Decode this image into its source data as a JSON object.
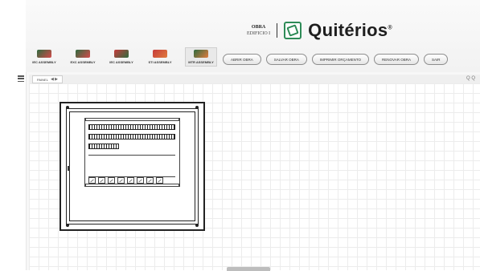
{
  "header": {
    "obra_label": "OBRA",
    "obra_value": "EDIFICIO I",
    "brand_name": "Quitérios"
  },
  "assemblies": [
    {
      "label": "IEC ASSEMBLY",
      "color1": "#2f6b3f",
      "color2": "#d44a4a",
      "active": false
    },
    {
      "label": "EXC ASSEMBLY",
      "color1": "#2f6b3f",
      "color2": "#d44a4a",
      "active": false
    },
    {
      "label": "IEC ASSEMBLY",
      "color1": "#c63c3c",
      "color2": "#2f6b3f",
      "active": false
    },
    {
      "label": "STI ASSEMBLY",
      "color1": "#c63c3c",
      "color2": "#e07b3d",
      "active": false
    },
    {
      "label": "MTR ASSEMBLY",
      "color1": "#2f6b3f",
      "color2": "#e07b3d",
      "active": true
    }
  ],
  "actions": [
    "ABRIR OBRA",
    "SALVAR OBRA",
    "IMPRIMIR ORÇAMENTO",
    "RENOVAR OBRA",
    "SAIR"
  ],
  "toolbar": {
    "tab_label": "PAINEL",
    "tab_controls": "◀ ▶",
    "zoom_label": "Q Q"
  }
}
